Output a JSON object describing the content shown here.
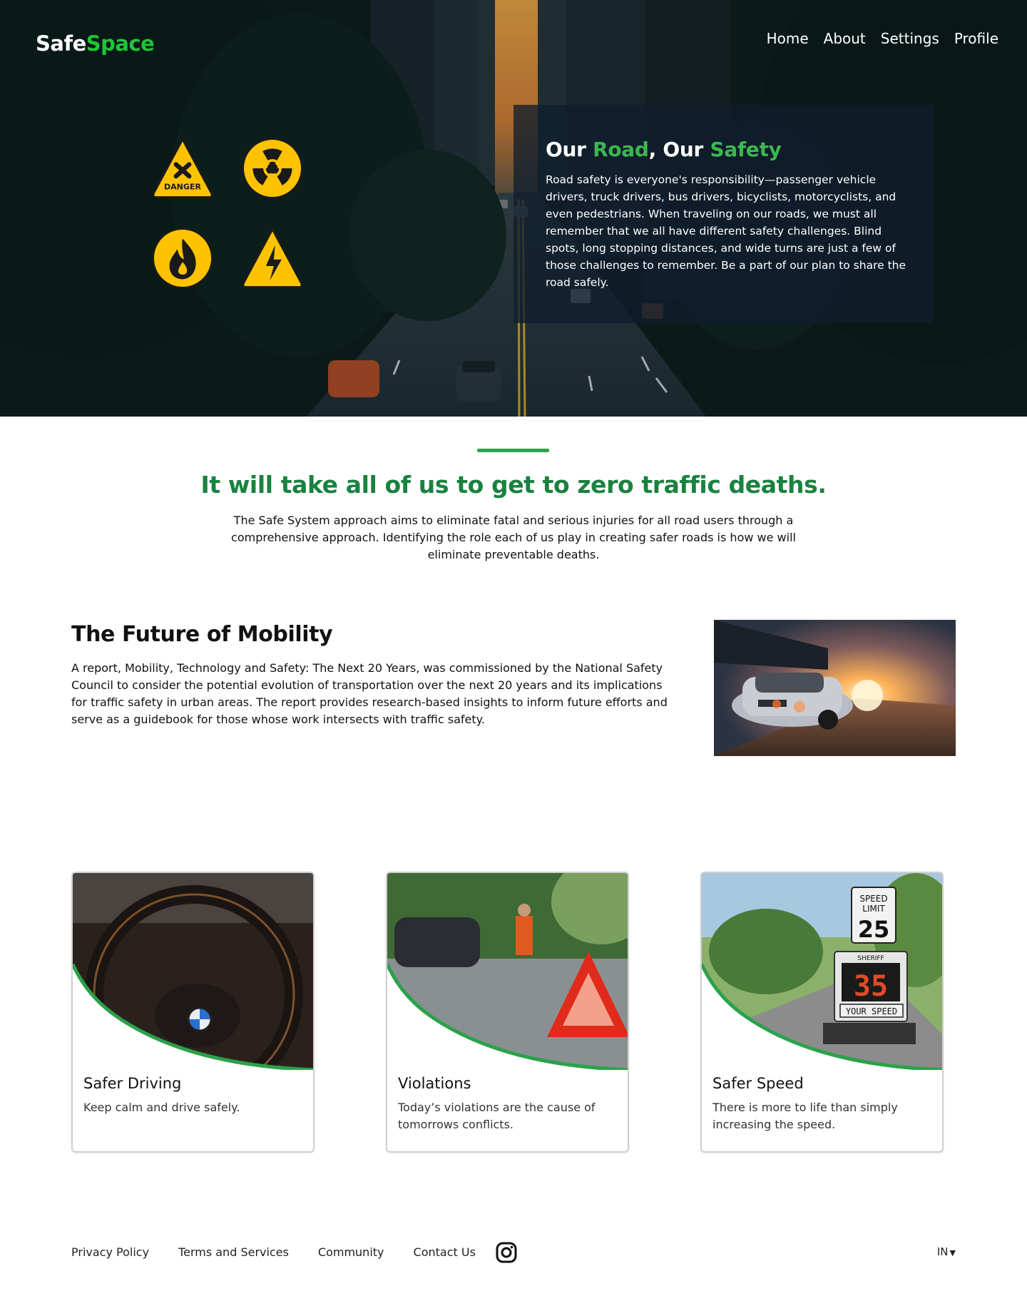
{
  "brand": {
    "part1": "Safe",
    "part2": "Space"
  },
  "nav": {
    "items": [
      "Home",
      "About",
      "Settings",
      "Profile"
    ]
  },
  "hero": {
    "title_parts": [
      "Our ",
      "Road",
      ", Our ",
      "Safety"
    ],
    "text": "Road safety is everyone's responsibility—passenger vehicle drivers, truck drivers, bus drivers, bicyclists, motorcyclists, and even pedestrians. When traveling on our roads, we must all remember that we all have different safety challenges. Blind spots, long stopping distances, and wide turns are just a few of those challenges to remember. Be a part of our plan to share the road safely.",
    "signs": [
      {
        "icon": "danger-sign-icon",
        "label": "DANGER"
      },
      {
        "icon": "radiation-sign-icon"
      },
      {
        "icon": "flammable-sign-icon"
      },
      {
        "icon": "high-voltage-sign-icon"
      }
    ]
  },
  "mission": {
    "title": "It will take all of us to get to zero traffic deaths.",
    "text": "The Safe System approach aims to eliminate fatal and serious injuries for all road users through a comprehensive approach. Identifying the role each of us play in creating safer roads is how we will eliminate preventable deaths."
  },
  "future": {
    "title": "The Future of Mobility",
    "text": "A report, Mobility, Technology and Safety: The Next 20 Years, was commissioned by the National Safety Council to consider the potential evolution of transportation over the next 20 years and its implications for traffic safety in urban areas. The report provides research-based insights to inform future efforts and serve as a guidebook for those whose work intersects with traffic safety."
  },
  "cards": [
    {
      "title": "Safer Driving",
      "text": "Keep calm and drive safely."
    },
    {
      "title": "Violations",
      "text": "Today’s violations are the cause of tomorrows conflicts."
    },
    {
      "title": "Safer Speed",
      "text": "There is more to life than simply increasing the speed.",
      "sign_top": "SPEED",
      "sign_mid": "LIMIT",
      "limit": "25",
      "badge": "SHERIFF",
      "speed": "35",
      "speed_label": "YOUR SPEED"
    }
  ],
  "footer": {
    "links": [
      "Privacy Policy",
      "Terms and Services",
      "Community",
      "Contact Us"
    ],
    "language": "IN"
  },
  "colors": {
    "accent": "#22c33a",
    "accent_dark": "#19823f",
    "rule": "#2aa24a",
    "sign_yellow": "#fdc300"
  }
}
